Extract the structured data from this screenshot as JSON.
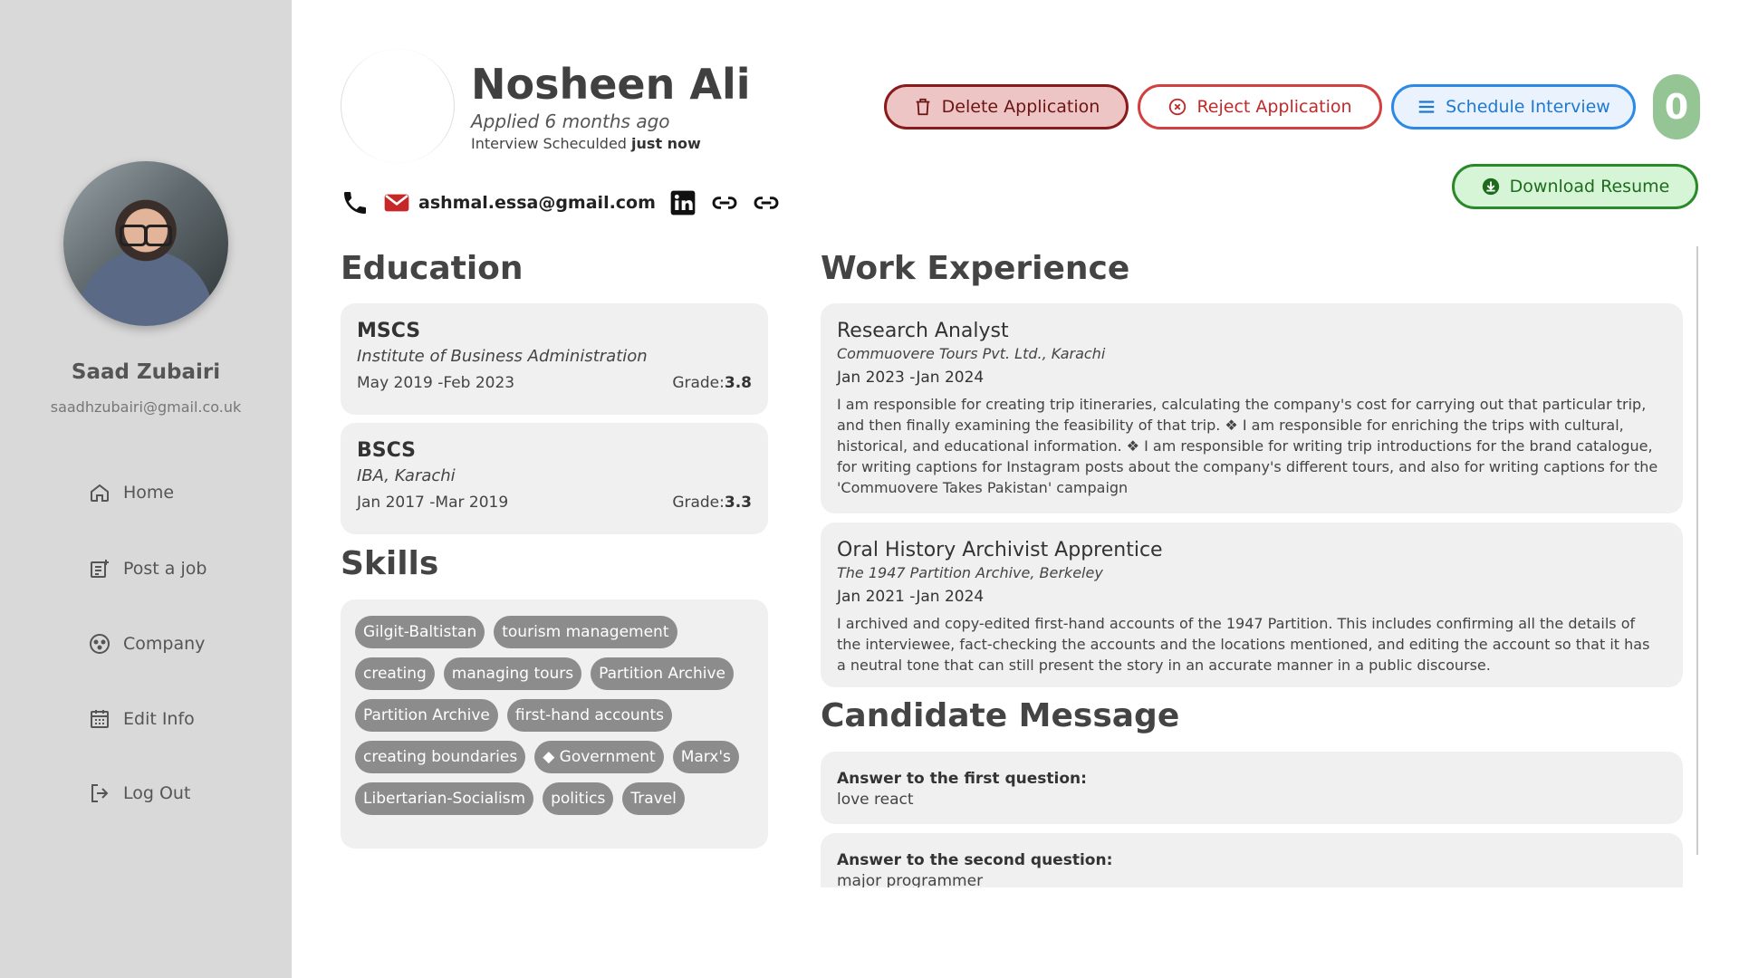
{
  "sidebar": {
    "user_name": "Saad Zubairi",
    "user_email": "saadhzubairi@gmail.co.uk",
    "items": [
      {
        "label": "Home",
        "icon": "home-icon"
      },
      {
        "label": "Post a job",
        "icon": "post-job-icon"
      },
      {
        "label": "Company",
        "icon": "company-icon"
      },
      {
        "label": "Edit Info",
        "icon": "calendar-icon"
      },
      {
        "label": "Log Out",
        "icon": "logout-icon"
      }
    ]
  },
  "candidate": {
    "name": "Nosheen Ali",
    "applied": "Applied 6 months ago",
    "scheduled_prefix": "Interview Scheculded ",
    "scheduled_when": "just now",
    "email": "ashmal.essa@gmail.com"
  },
  "actions": {
    "delete_label": "Delete Application",
    "reject_label": "Reject Application",
    "schedule_label": "Schedule Interview",
    "download_label": "Download Resume",
    "counter": "0"
  },
  "colors": {
    "sidebar_bg": "#d9d9d9",
    "delete": "#8b1a1a",
    "reject": "#d24040",
    "schedule": "#2a8ae6",
    "download": "#2a8a2a",
    "counter_bg": "#95c595",
    "chip_bg": "#8c8c8c"
  },
  "education": {
    "title": "Education",
    "grade_label": "Grade:",
    "items": [
      {
        "degree": "MSCS",
        "institution": "Institute of Business Administration",
        "dates": "May 2019 -Feb 2023",
        "grade": "3.8"
      },
      {
        "degree": "BSCS",
        "institution": "IBA, Karachi",
        "dates": "Jan 2017 -Mar 2019",
        "grade": "3.3"
      }
    ]
  },
  "skills": {
    "title": "Skills",
    "items": [
      "Gilgit-Baltistan",
      "tourism management",
      "creating",
      "managing tours",
      "Partition Archive",
      "Partition Archive",
      "first-hand accounts",
      "creating boundaries",
      "◆ Government",
      "Marx's",
      "Libertarian-Socialism",
      "politics",
      "Travel"
    ]
  },
  "work": {
    "title": "Work Experience",
    "items": [
      {
        "title": "Research Analyst",
        "company": "Commuovere Tours Pvt. Ltd., Karachi",
        "dates": "Jan 2023 -Jan 2024",
        "description": "I am responsible for creating trip itineraries, calculating the company's cost for carrying out that particular trip, and then finally examining the feasibility of that trip. ❖ I am responsible for enriching the trips with cultural, historical, and educational information. ❖ I am responsible for writing trip introductions for the brand catalogue, for writing captions for Instagram posts about the company's different tours, and also for writing captions for the 'Commuovere Takes Pakistan' campaign"
      },
      {
        "title": "Oral History Archivist Apprentice",
        "company": "The 1947 Partition Archive, Berkeley",
        "dates": "Jan 2021 -Jan 2024",
        "description": "I archived and copy-edited first-hand accounts of the 1947 Partition. This includes confirming all the details of the interviewee, fact-checking the accounts and the locations mentioned, and editing the account so that it has a neutral tone that can still present the story in an accurate manner in a public discourse."
      }
    ]
  },
  "messages": {
    "title": "Candidate Message",
    "items": [
      {
        "question": "Answer to the first question:",
        "answer": "love react"
      },
      {
        "question": "Answer to the second question:",
        "answer": "major programmer"
      }
    ]
  }
}
